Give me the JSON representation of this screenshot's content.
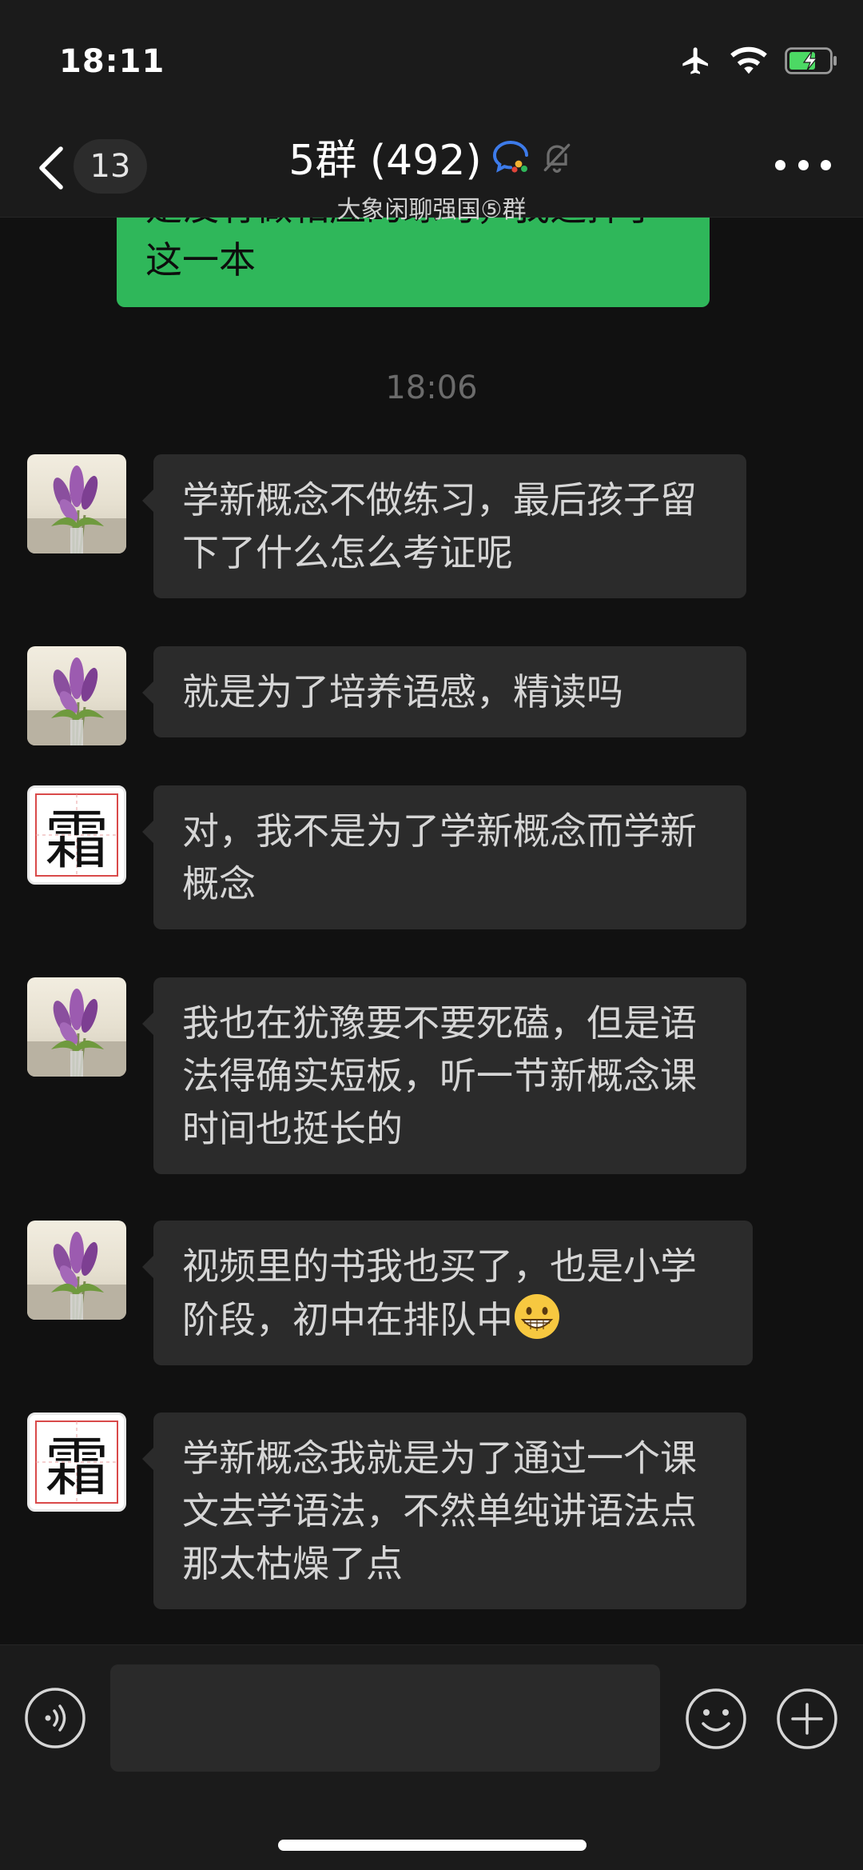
{
  "status_bar": {
    "time": "18:11",
    "icons": [
      "airplane-icon",
      "wifi-icon",
      "battery-charging-icon"
    ]
  },
  "nav": {
    "unread_count": "13",
    "title": "5群 (492)",
    "subtitle": "大象闲聊强国⑤群",
    "icons": [
      "back-chevron-icon",
      "chat-bubble-icon",
      "mute-bell-icon",
      "more-icon"
    ]
  },
  "messages": {
    "prev_outgoing_tail": "是没有做相应的练习，我选择了这一本",
    "timestamp": "18:06",
    "items": [
      {
        "avatar": "flower",
        "text": "学新概念不做练习，最后孩子留下了什么怎么考证呢"
      },
      {
        "avatar": "flower",
        "text": "就是为了培养语感，精读吗"
      },
      {
        "avatar": "char",
        "avatar_char": "霜",
        "text": "对，我不是为了学新概念而学新概念"
      },
      {
        "avatar": "flower",
        "text": "我也在犹豫要不要死磕，但是语法得确实短板，听一节新概念课时间也挺长的"
      },
      {
        "avatar": "flower",
        "text": "视频里的书我也买了，也是小学阶段，初中在排队中",
        "emoji": "grinning-face-icon"
      },
      {
        "avatar": "char",
        "avatar_char": "霜",
        "text": "学新概念我就是为了通过一个课文去学语法，不然单纯讲语法点那太枯燥了点"
      }
    ]
  },
  "input_bar": {
    "placeholder": "",
    "icons": [
      "voice-icon",
      "emoji-icon",
      "plus-icon"
    ]
  },
  "colors": {
    "background": "#111111",
    "bar": "#1b1b1b",
    "incoming_bubble": "#2b2b2b",
    "outgoing_bubble": "#2fb75a",
    "battery": "#4cd964"
  }
}
